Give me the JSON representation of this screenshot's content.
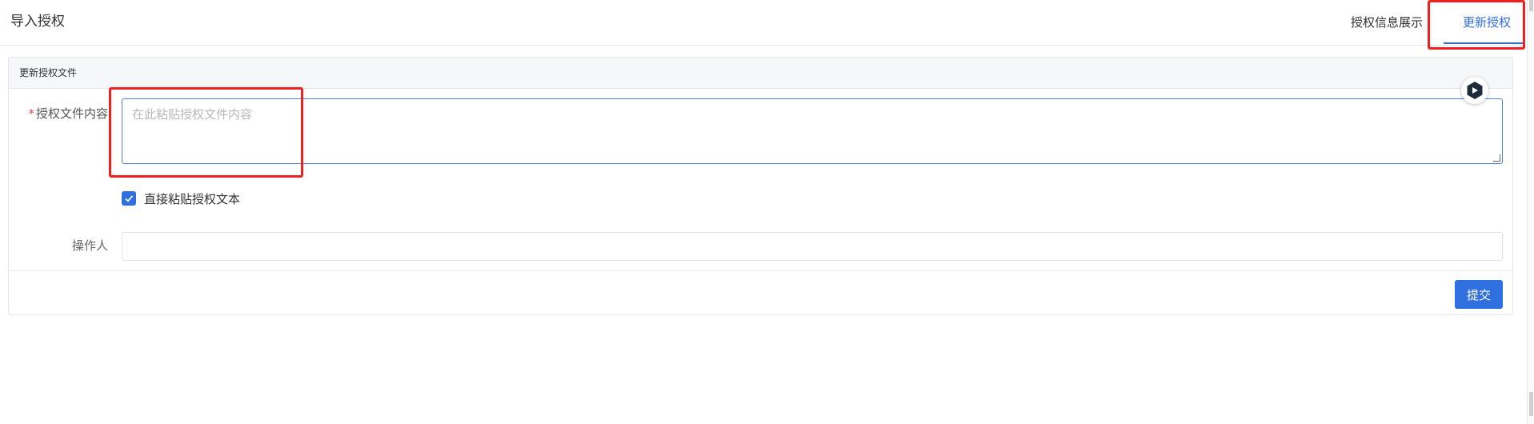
{
  "header": {
    "title": "导入授权",
    "tabs": [
      {
        "label": "授权信息展示",
        "active": false
      },
      {
        "label": "更新授权",
        "active": true
      }
    ]
  },
  "card": {
    "title": "更新授权文件",
    "form": {
      "content_label": "授权文件内容",
      "required_mark": "*",
      "content_placeholder": "在此粘贴授权文件内容",
      "content_value": "",
      "paste_checkbox_label": "直接粘贴授权文本",
      "paste_checkbox_checked": true,
      "operator_label": "操作人",
      "operator_value": ""
    },
    "submit_label": "提交"
  },
  "colors": {
    "accent": "#2f6fe0",
    "highlight": "#f21f1f",
    "required": "#e34d4d"
  }
}
